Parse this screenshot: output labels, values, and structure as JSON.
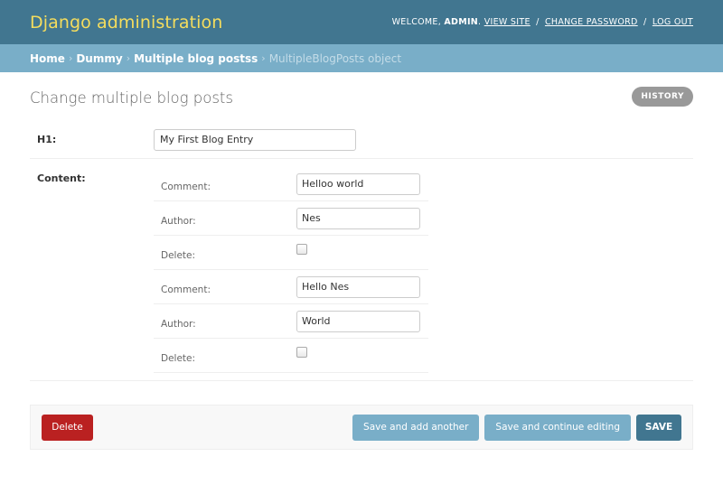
{
  "header": {
    "brand": "Django administration",
    "welcome": "Welcome,",
    "user": "admin",
    "view_site": "View site",
    "change_password": "Change password",
    "log_out": "Log out",
    "separator": "/"
  },
  "breadcrumbs": {
    "home": "Home",
    "app": "Dummy",
    "model": "Multiple blog postss",
    "current": "MultipleBlogPosts object",
    "arrow": "›"
  },
  "page": {
    "title": "Change multiple blog posts",
    "history_label": "History"
  },
  "form": {
    "h1_label": "H1:",
    "h1_value": "My First Blog Entry",
    "content_label": "Content:",
    "entries": [
      {
        "comment_label": "Comment:",
        "comment_value": "Helloo world",
        "author_label": "Author:",
        "author_value": "Nes",
        "delete_label": "Delete:"
      },
      {
        "comment_label": "Comment:",
        "comment_value": "Hello Nes",
        "author_label": "Author:",
        "author_value": "World",
        "delete_label": "Delete:"
      }
    ]
  },
  "actions": {
    "delete": "Delete",
    "save_add_another": "Save and add another",
    "save_continue": "Save and continue editing",
    "save": "SAVE"
  },
  "colors": {
    "header_bg": "#417690",
    "brand": "#f5dd5d",
    "breadcrumb_bg": "#79aec8",
    "delete_btn": "#ba2121",
    "secondary_btn": "#79aec8",
    "primary_btn": "#417690"
  }
}
